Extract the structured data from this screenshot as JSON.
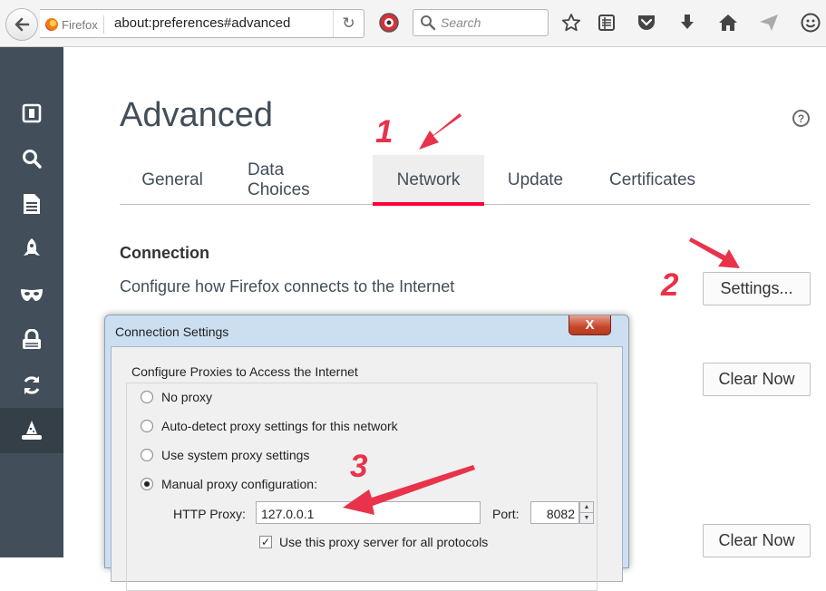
{
  "toolbar": {
    "identity_label": "Firefox",
    "url": "about:preferences#advanced",
    "search_placeholder": "Search"
  },
  "sidebar": {
    "items": [
      {
        "icon": "general-icon"
      },
      {
        "icon": "search-icon"
      },
      {
        "icon": "content-icon"
      },
      {
        "icon": "applications-icon"
      },
      {
        "icon": "privacy-mask-icon"
      },
      {
        "icon": "security-lock-icon"
      },
      {
        "icon": "sync-icon"
      },
      {
        "icon": "advanced-wizard-icon",
        "selected": true
      }
    ]
  },
  "main": {
    "title": "Advanced",
    "tabs": [
      {
        "label": "General"
      },
      {
        "label": "Data Choices"
      },
      {
        "label": "Network",
        "selected": true
      },
      {
        "label": "Update"
      },
      {
        "label": "Certificates"
      }
    ],
    "connection": {
      "heading": "Connection",
      "description": "Configure how Firefox connects to the Internet",
      "settings_button": "Settings..."
    },
    "clear_now_1": "Clear Now",
    "clear_now_2": "Clear Now"
  },
  "dialog": {
    "title": "Connection Settings",
    "close_label": "X",
    "group_title": "Configure Proxies to Access the Internet",
    "options": [
      {
        "label": "No proxy",
        "checked": false
      },
      {
        "label": "Auto-detect proxy settings for this network",
        "checked": false
      },
      {
        "label": "Use system proxy settings",
        "checked": false
      },
      {
        "label": "Manual proxy configuration:",
        "checked": true
      }
    ],
    "http_proxy_label": "HTTP Proxy:",
    "http_proxy_value": "127.0.0.1",
    "port_label": "Port:",
    "port_value": "8082",
    "use_all_protocols_label": "Use this proxy server for all protocols",
    "use_all_protocols_checked": true
  },
  "annotations": {
    "step1": "1",
    "step2": "2",
    "step3": "3",
    "accent_color": "#e8334b"
  }
}
